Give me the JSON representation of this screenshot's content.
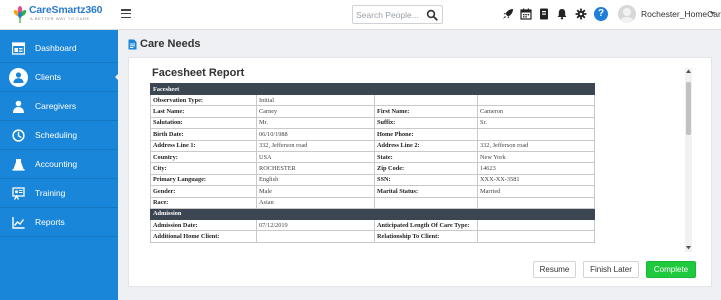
{
  "brand": {
    "name": "CareSmartz360",
    "tagline": "A BETTER WAY TO CARE"
  },
  "search": {
    "placeholder": "Search People..."
  },
  "user": {
    "name": "Rochester_HomeCare"
  },
  "sidebar": {
    "items": [
      {
        "label": "Dashboard",
        "icon": "dashboard-icon",
        "active": false
      },
      {
        "label": "Clients",
        "icon": "user-icon",
        "active": true
      },
      {
        "label": "Caregivers",
        "icon": "caregiver-icon",
        "active": false
      },
      {
        "label": "Scheduling",
        "icon": "clock-icon",
        "active": false
      },
      {
        "label": "Accounting",
        "icon": "accounting-icon",
        "active": false
      },
      {
        "label": "Training",
        "icon": "training-icon",
        "active": false
      },
      {
        "label": "Reports",
        "icon": "reports-icon",
        "active": false
      }
    ]
  },
  "page": {
    "title": "Care Needs"
  },
  "report": {
    "title": "Facesheet Report",
    "sections": {
      "facesheet": "Facesheet",
      "admission": "Admission"
    },
    "facesheet_rows": [
      [
        "Observation Type:",
        "Initial",
        "",
        ""
      ],
      [
        "Last Name:",
        "Carney",
        "First Name:",
        "Cameron"
      ],
      [
        "Salutation:",
        "Mr.",
        "Suffix:",
        "Sr."
      ],
      [
        "Birth Date:",
        "06/10/1988",
        "Home Phone:",
        ""
      ],
      [
        "Address Line 1:",
        "332, Jefferson road",
        "Address Line 2:",
        "332, Jefferson road"
      ],
      [
        "Country:",
        "USA",
        "State:",
        "New York"
      ],
      [
        "City:",
        "ROCHESTER",
        "Zip Code:",
        "14623"
      ],
      [
        "Primary Language:",
        "English",
        "SSN:",
        "XXX-XX-3581"
      ],
      [
        "Gender:",
        "Male",
        "Marital Status:",
        "Married"
      ],
      [
        "Race:",
        "Asian",
        "",
        ""
      ]
    ],
    "admission_rows": [
      [
        "Admission Date:",
        "07/12/2019",
        "Anticipated Length Of Care Type:",
        ""
      ],
      [
        "Additional Home Client:",
        "",
        "Relationship To Client:",
        ""
      ]
    ]
  },
  "actions": {
    "resume": "Resume",
    "finish_later": "Finish Later",
    "complete": "Complete"
  },
  "colors": {
    "sidebar": "#1a86d9",
    "complete_button": "#1fc93d",
    "section_header": "#3c4652",
    "help_icon": "#1f7fd8"
  }
}
